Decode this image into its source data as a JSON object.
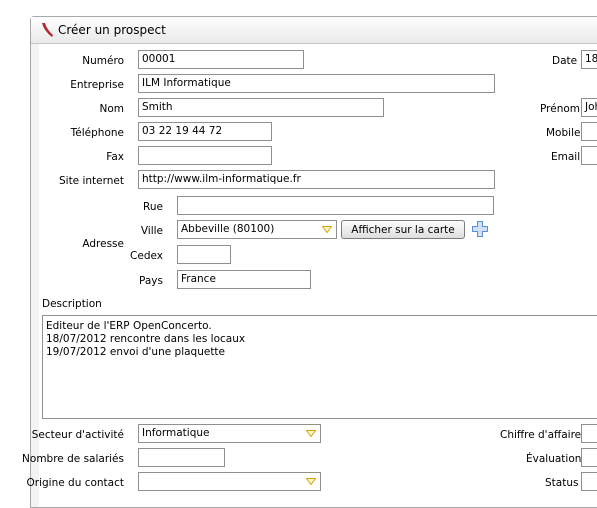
{
  "window": {
    "title": "Créer un prospect"
  },
  "form": {
    "numero": {
      "label": "Numéro",
      "value": "00001"
    },
    "date": {
      "label": "Date",
      "value": "18/"
    },
    "entreprise": {
      "label": "Entreprise",
      "value": "ILM Informatique"
    },
    "nom": {
      "label": "Nom",
      "value": "Smith"
    },
    "prenom": {
      "label": "Prénom",
      "value": "Joh"
    },
    "telephone": {
      "label": "Téléphone",
      "value": "03 22 19 44 72"
    },
    "mobile": {
      "label": "Mobile",
      "value": ""
    },
    "fax": {
      "label": "Fax",
      "value": ""
    },
    "email": {
      "label": "Email",
      "value": ""
    },
    "site": {
      "label": "Site internet",
      "value": "http://www.ilm-informatique.fr"
    },
    "adresse": {
      "label": "Adresse",
      "rue": {
        "label": "Rue",
        "value": ""
      },
      "ville": {
        "label": "Ville",
        "value": "Abbeville (80100)"
      },
      "map_button": "Afficher sur la carte",
      "cedex": {
        "label": "Cedex",
        "value": ""
      },
      "pays": {
        "label": "Pays",
        "value": "France"
      }
    },
    "description": {
      "label": "Description",
      "lines": [
        "Editeur de l'ERP OpenConcerto.",
        "18/07/2012 rencontre dans les locaux",
        "19/07/2012 envoi d'une plaquette"
      ]
    },
    "secteur": {
      "label": "Secteur d'activité",
      "value": "Informatique"
    },
    "chiffre": {
      "label": "Chiffre d'affaire",
      "value": ""
    },
    "salaries": {
      "label": "Nombre de salariés",
      "value": ""
    },
    "evaluation": {
      "label": "Évaluation",
      "value": ""
    },
    "origine": {
      "label": "Origine du contact",
      "value": ""
    },
    "status": {
      "label": "Status",
      "value": ""
    }
  },
  "icons": {
    "logo": "app-logo-icon",
    "dropdown": "chevron-down-icon",
    "add": "plus-icon"
  },
  "colors": {
    "logo": "#b5282e",
    "plus": "#5b8fd6",
    "dropdown_arrow": "#d9a200"
  }
}
